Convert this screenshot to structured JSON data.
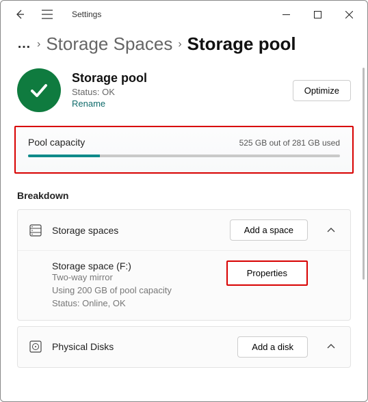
{
  "titlebar": {
    "app_title": "Settings"
  },
  "breadcrumbs": {
    "parent": "Storage Spaces",
    "current": "Storage pool"
  },
  "pool": {
    "title": "Storage pool",
    "status": "Status: OK",
    "rename": "Rename",
    "optimize": "Optimize"
  },
  "capacity": {
    "label": "Pool capacity",
    "text": "525  GB out of 281  GB used"
  },
  "breakdown": {
    "heading": "Breakdown"
  },
  "spaces_card": {
    "title": "Storage spaces",
    "add": "Add a space",
    "item": {
      "name": "Storage space (F:)",
      "type": "Two-way mirror",
      "usage": "Using 200  GB of pool capacity",
      "status": "Status: Online, OK",
      "properties": "Properties"
    }
  },
  "disks_card": {
    "title": "Physical Disks",
    "add": "Add a disk"
  }
}
